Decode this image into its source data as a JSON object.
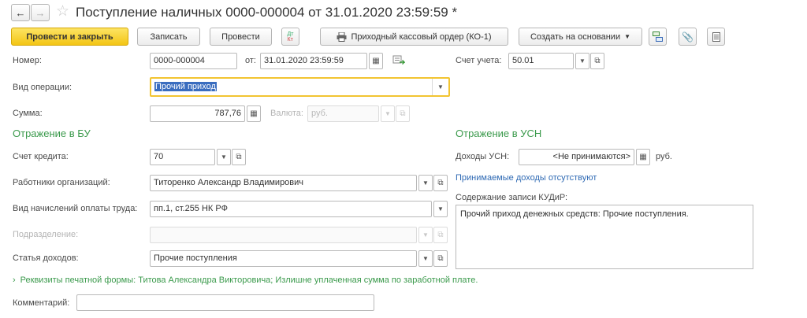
{
  "title": "Поступление наличных 0000-000004 от 31.01.2020 23:59:59 *",
  "toolbar": {
    "post_close": "Провести и закрыть",
    "save": "Записать",
    "post": "Провести",
    "dt_kt_top": "Дт",
    "dt_kt_bottom": "Кт",
    "print_order": "Приходный кассовый ордер (КО-1)",
    "create_based": "Создать на основании"
  },
  "form": {
    "number_label": "Номер:",
    "number_value": "0000-000004",
    "from_label": "от:",
    "date_value": "31.01.2020 23:59:59",
    "account_label": "Счет учета:",
    "account_value": "50.01",
    "operation_label": "Вид операции:",
    "operation_value": "Прочий приход",
    "sum_label": "Сумма:",
    "sum_value": "787,76",
    "currency_label": "Валюта:",
    "currency_value": "руб."
  },
  "bu": {
    "heading": "Отражение в БУ",
    "credit_label": "Счет кредита:",
    "credit_value": "70",
    "employees_label": "Работники организаций:",
    "employees_value": "Титоренко Александр Владимирович",
    "accrual_label": "Вид начислений оплаты труда:",
    "accrual_value": "пп.1, ст.255 НК РФ",
    "division_label": "Подразделение:",
    "division_value": "",
    "income_label": "Статья доходов:",
    "income_value": "Прочие поступления"
  },
  "usn": {
    "heading": "Отражение в УСН",
    "income_label": "Доходы УСН:",
    "income_value": "<Не принимаются>",
    "income_unit": "руб.",
    "accepted_link": "Принимаемые доходы отсутствуют",
    "kudir_label": "Содержание записи КУДиР:",
    "kudir_value": "Прочий приход денежных средств: Прочие поступления."
  },
  "print_requisites": "Реквизиты печатной формы: Титова Александра Викторовича; Излишне уплаченная сумма по заработной плате.",
  "comment_label": "Комментарий:",
  "comment_value": ""
}
